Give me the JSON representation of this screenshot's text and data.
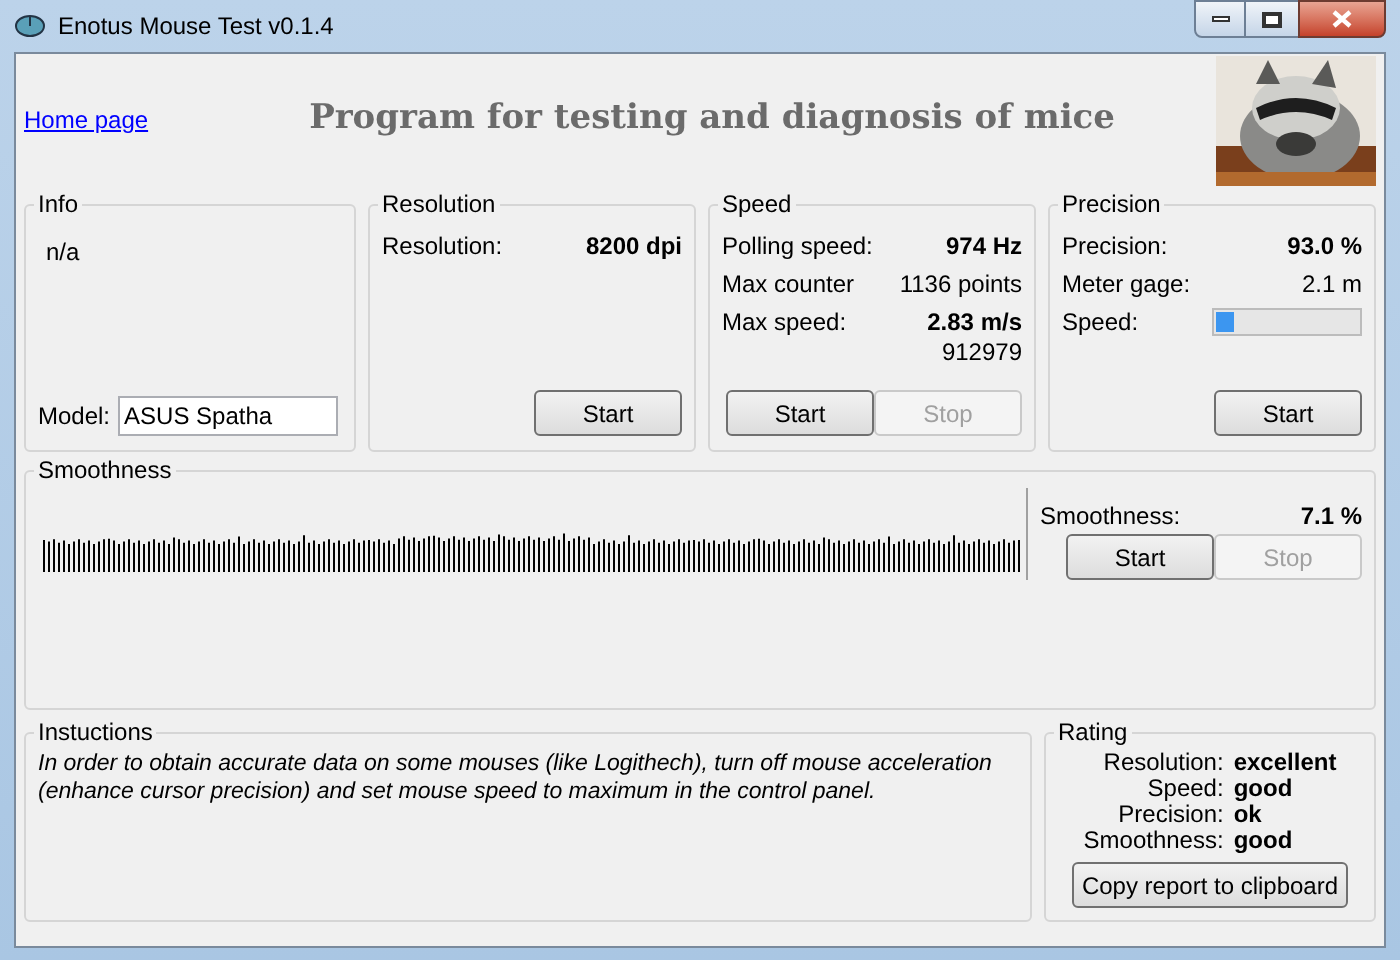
{
  "window": {
    "title": "Enotus Mouse Test v0.1.4"
  },
  "header": {
    "link": "Home page",
    "title": "Program for testing and diagnosis of mice"
  },
  "info": {
    "title": "Info",
    "text": "n/a",
    "model_label": "Model:",
    "model_value": "ASUS Spatha"
  },
  "resolution": {
    "title": "Resolution",
    "rows": [
      {
        "label": "Resolution:",
        "value": "8200 dpi",
        "emphasized": true
      }
    ],
    "buttons": [
      {
        "label": "Start",
        "disabled": false
      }
    ]
  },
  "speed": {
    "title": "Speed",
    "rows": [
      {
        "label": "Polling speed:",
        "value": "974 Hz",
        "emphasized": true
      },
      {
        "label": "Max counter",
        "value": "1136 points",
        "emphasized": false
      },
      {
        "label": "Max  speed:",
        "value": "2.83 m/s",
        "emphasized": true
      }
    ],
    "extra": "912979",
    "buttons": [
      {
        "label": "Start",
        "disabled": false
      },
      {
        "label": "Stop",
        "disabled": true
      }
    ]
  },
  "precision": {
    "title": "Precision",
    "rows": [
      {
        "label": "Precision:",
        "value": "93.0 %",
        "emphasized": true
      },
      {
        "label": "Meter gage:",
        "value": "2.1 m",
        "emphasized": false
      }
    ],
    "meter": {
      "label": "Speed:",
      "level": 0.13
    },
    "buttons": [
      {
        "label": "Start",
        "disabled": false
      }
    ]
  },
  "smoothness": {
    "title": "Smoothness",
    "rows": [
      {
        "label": "Smoothness:",
        "value": "7.1 %",
        "emphasized": true
      }
    ],
    "buttons": [
      {
        "label": "Start",
        "disabled": false
      },
      {
        "label": "Stop",
        "disabled": true
      }
    ]
  },
  "instructions": {
    "title": "Instuctions",
    "text": "In order to obtain accurate data on some mouses (like Logithech), turn off mouse acceleration (enhance cursor precision) and set mouse speed to maximum in the control panel."
  },
  "rating": {
    "title": "Rating",
    "rows": [
      {
        "label": "Resolution:",
        "value": "excellent"
      },
      {
        "label": "Speed:",
        "value": "good"
      },
      {
        "label": "Precision:",
        "value": "ok"
      },
      {
        "label": "Smoothness:",
        "value": "good"
      }
    ],
    "button": "Copy report to clipboard"
  }
}
